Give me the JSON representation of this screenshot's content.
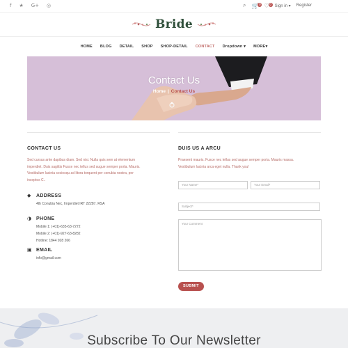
{
  "topbar": {
    "social_icons": [
      "facebook-icon",
      "twitter-icon",
      "google-plus-icon",
      "instagram-icon"
    ],
    "social_glyphs": [
      "f",
      "★",
      "G+",
      "◎"
    ],
    "cart_count": "0",
    "wishlist_count": "0",
    "signin_label": "Sign in",
    "register_label": "Register"
  },
  "logo": {
    "text": "Bride"
  },
  "nav": {
    "items": [
      "HOME",
      "BLOG",
      "DETAIL",
      "SHOP",
      "SHOP-DETAIL",
      "CONTACT",
      "Dropdown",
      "MORE"
    ],
    "active": "CONTACT"
  },
  "hero": {
    "title": "Contact Us",
    "crumb_home": "Home",
    "crumb_sep": "|",
    "crumb_current": "Contact Us"
  },
  "contact": {
    "title": "CONTACT US",
    "lines": [
      "Sed cursus ante dapibus diam. Sed nisi. Nulla quis sem at elementum",
      "imperdiet. Duis sagittis Fusce nec tellus sed augue semper porta. Mauris.",
      "Vestibulum lacinia sociosqu ad litora torquent per conubia nostra, per",
      "inceptos C.."
    ],
    "address_label": "ADDRESS",
    "address_value": "4th Conubia Nec, Imperdiet IRT 22287. RSA",
    "phone_label": "PHONE",
    "phone_lines": [
      "Mobile 1: (+01)-635-63-7272",
      "Mobile 2: (+01)-927-63-8282",
      "Hotline: 1844 928 266"
    ],
    "email_label": "EMAIL",
    "email_value": "info@gmail.com"
  },
  "form": {
    "title": "DUIS US A ARCU",
    "lines": [
      "Praesent mauris. Fusce nec tellus sed augue semper porta. Mauris massa.",
      "Vestibulum lacinia arca eget nulla. Thank you!"
    ],
    "name_placeholder": "Your Name*",
    "email_placeholder": "Your Email*",
    "subject_placeholder": "Subject*",
    "comment_placeholder": "Your Comment",
    "submit_label": "SUBMIT"
  },
  "newsletter": {
    "title": "Subscribe To Our Newsletter"
  },
  "colors": {
    "accent": "#b8514f",
    "hero_bg": "#d6bfd8",
    "logo": "#2f4f3a"
  }
}
